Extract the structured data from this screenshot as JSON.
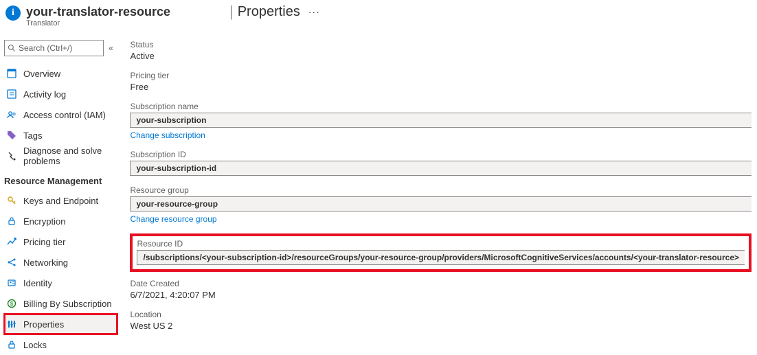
{
  "header": {
    "resource_name": "your-translator-resource",
    "resource_type": "Translator",
    "page_title": "Properties"
  },
  "search": {
    "placeholder": "Search (Ctrl+/)"
  },
  "sidebar": {
    "items_top": [
      {
        "label": "Overview"
      },
      {
        "label": "Activity log"
      },
      {
        "label": "Access control (IAM)"
      },
      {
        "label": "Tags"
      },
      {
        "label": "Diagnose and solve problems"
      }
    ],
    "section_label": "Resource Management",
    "items_rm": [
      {
        "label": "Keys and Endpoint"
      },
      {
        "label": "Encryption"
      },
      {
        "label": "Pricing tier"
      },
      {
        "label": "Networking"
      },
      {
        "label": "Identity"
      },
      {
        "label": "Billing By Subscription"
      },
      {
        "label": "Properties"
      },
      {
        "label": "Locks"
      }
    ]
  },
  "props": {
    "status_label": "Status",
    "status_value": "Active",
    "tier_label": "Pricing tier",
    "tier_value": "Free",
    "sub_name_label": "Subscription name",
    "sub_name_value": "your-subscription",
    "sub_name_link": "Change subscription",
    "sub_id_label": "Subscription ID",
    "sub_id_value": "your-subscription-id",
    "rg_label": "Resource group",
    "rg_value": "your-resource-group",
    "rg_link": "Change resource group",
    "rid_label": "Resource ID",
    "rid_value": "/subscriptions/<your-subscription-id>/resourceGroups/your-resource-group/providers/MicrosoftCognitiveServices/accounts/<your-translator-resource>",
    "created_label": "Date Created",
    "created_value": "6/7/2021, 4:20:07 PM",
    "loc_label": "Location",
    "loc_value": "West US 2"
  }
}
